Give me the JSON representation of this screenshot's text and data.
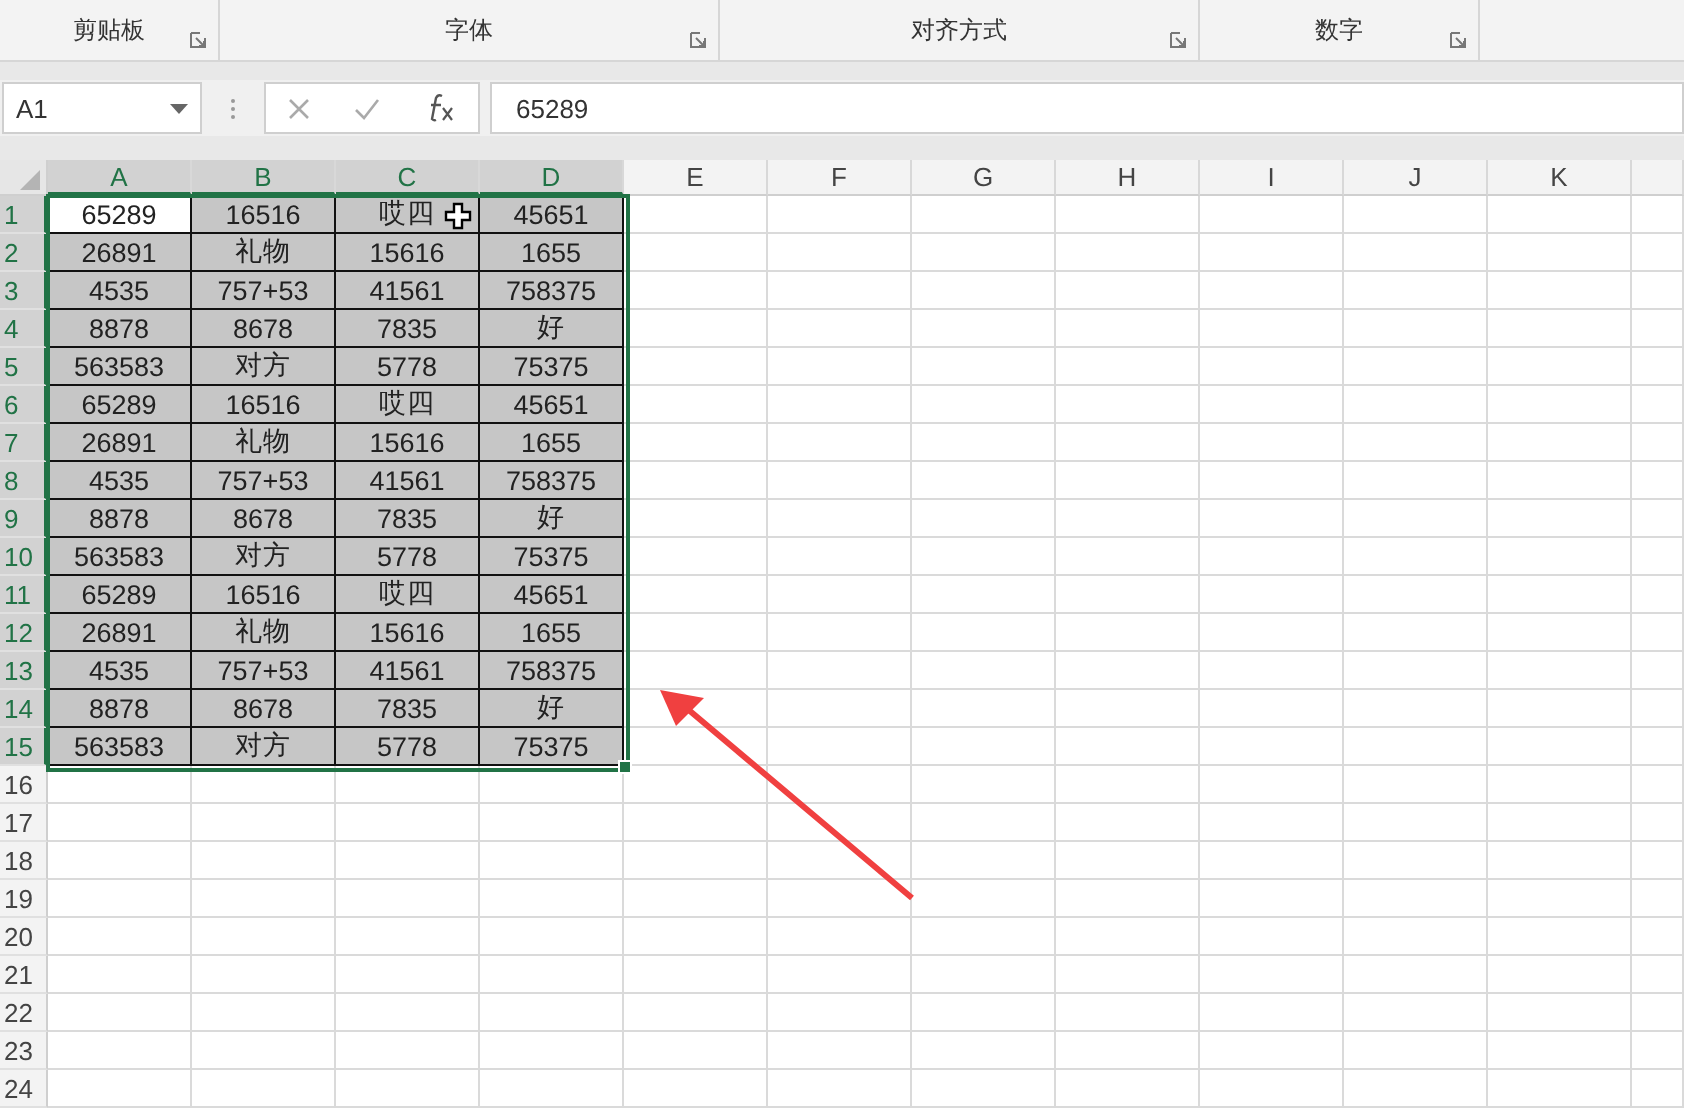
{
  "ribbon_groups": [
    {
      "label": "剪贴板"
    },
    {
      "label": "字体"
    },
    {
      "label": "对齐方式"
    },
    {
      "label": "数字"
    }
  ],
  "name_box": {
    "value": "A1"
  },
  "formula_bar": {
    "value": "65289"
  },
  "columns": [
    {
      "label": "A",
      "selected": true
    },
    {
      "label": "B",
      "selected": true
    },
    {
      "label": "C",
      "selected": true
    },
    {
      "label": "D",
      "selected": true
    },
    {
      "label": "E",
      "selected": false
    },
    {
      "label": "F",
      "selected": false
    },
    {
      "label": "G",
      "selected": false
    },
    {
      "label": "H",
      "selected": false
    },
    {
      "label": "I",
      "selected": false
    },
    {
      "label": "J",
      "selected": false
    },
    {
      "label": "K",
      "selected": false
    }
  ],
  "rows": [
    {
      "header": "1",
      "selected": true,
      "cells": [
        {
          "text": "65289",
          "active": true
        },
        {
          "text": "16516",
          "active": false
        },
        {
          "text": "哎四",
          "active": false
        },
        {
          "text": "45651",
          "active": false
        }
      ]
    },
    {
      "header": "2",
      "selected": true,
      "cells": [
        {
          "text": "26891",
          "active": false
        },
        {
          "text": "礼物",
          "active": false
        },
        {
          "text": "15616",
          "active": false
        },
        {
          "text": "1655",
          "active": false
        }
      ]
    },
    {
      "header": "3",
      "selected": true,
      "cells": [
        {
          "text": "4535",
          "active": false
        },
        {
          "text": "757+53",
          "active": false
        },
        {
          "text": "41561",
          "active": false
        },
        {
          "text": "758375",
          "active": false
        }
      ]
    },
    {
      "header": "4",
      "selected": true,
      "cells": [
        {
          "text": "8878",
          "active": false
        },
        {
          "text": "8678",
          "active": false
        },
        {
          "text": "7835",
          "active": false
        },
        {
          "text": "好",
          "active": false
        }
      ]
    },
    {
      "header": "5",
      "selected": true,
      "cells": [
        {
          "text": "563583",
          "active": false
        },
        {
          "text": "对方",
          "active": false
        },
        {
          "text": "5778",
          "active": false
        },
        {
          "text": "75375",
          "active": false
        }
      ]
    },
    {
      "header": "6",
      "selected": true,
      "cells": [
        {
          "text": "65289",
          "active": false
        },
        {
          "text": "16516",
          "active": false
        },
        {
          "text": "哎四",
          "active": false
        },
        {
          "text": "45651",
          "active": false
        }
      ]
    },
    {
      "header": "7",
      "selected": true,
      "cells": [
        {
          "text": "26891",
          "active": false
        },
        {
          "text": "礼物",
          "active": false
        },
        {
          "text": "15616",
          "active": false
        },
        {
          "text": "1655",
          "active": false
        }
      ]
    },
    {
      "header": "8",
      "selected": true,
      "cells": [
        {
          "text": "4535",
          "active": false
        },
        {
          "text": "757+53",
          "active": false
        },
        {
          "text": "41561",
          "active": false
        },
        {
          "text": "758375",
          "active": false
        }
      ]
    },
    {
      "header": "9",
      "selected": true,
      "cells": [
        {
          "text": "8878",
          "active": false
        },
        {
          "text": "8678",
          "active": false
        },
        {
          "text": "7835",
          "active": false
        },
        {
          "text": "好",
          "active": false
        }
      ]
    },
    {
      "header": "10",
      "selected": true,
      "cells": [
        {
          "text": "563583",
          "active": false
        },
        {
          "text": "对方",
          "active": false
        },
        {
          "text": "5778",
          "active": false
        },
        {
          "text": "75375",
          "active": false
        }
      ]
    },
    {
      "header": "11",
      "selected": true,
      "cells": [
        {
          "text": "65289",
          "active": false
        },
        {
          "text": "16516",
          "active": false
        },
        {
          "text": "哎四",
          "active": false
        },
        {
          "text": "45651",
          "active": false
        }
      ]
    },
    {
      "header": "12",
      "selected": true,
      "cells": [
        {
          "text": "26891",
          "active": false
        },
        {
          "text": "礼物",
          "active": false
        },
        {
          "text": "15616",
          "active": false
        },
        {
          "text": "1655",
          "active": false
        }
      ]
    },
    {
      "header": "13",
      "selected": true,
      "cells": [
        {
          "text": "4535",
          "active": false
        },
        {
          "text": "757+53",
          "active": false
        },
        {
          "text": "41561",
          "active": false
        },
        {
          "text": "758375",
          "active": false
        }
      ]
    },
    {
      "header": "14",
      "selected": true,
      "cells": [
        {
          "text": "8878",
          "active": false
        },
        {
          "text": "8678",
          "active": false
        },
        {
          "text": "7835",
          "active": false
        },
        {
          "text": "好",
          "active": false
        }
      ]
    },
    {
      "header": "15",
      "selected": true,
      "cells": [
        {
          "text": "563583",
          "active": false
        },
        {
          "text": "对方",
          "active": false
        },
        {
          "text": "5778",
          "active": false
        },
        {
          "text": "75375",
          "active": false
        }
      ]
    },
    {
      "header": "16",
      "selected": false
    },
    {
      "header": "17",
      "selected": false
    },
    {
      "header": "18",
      "selected": false
    },
    {
      "header": "19",
      "selected": false
    },
    {
      "header": "20",
      "selected": false
    },
    {
      "header": "21",
      "selected": false
    },
    {
      "header": "22",
      "selected": false
    },
    {
      "header": "23",
      "selected": false
    },
    {
      "header": "24",
      "selected": false
    }
  ]
}
